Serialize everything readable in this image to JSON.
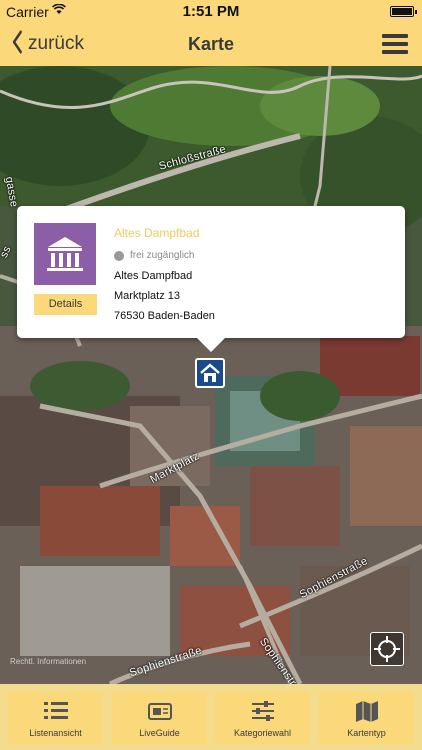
{
  "status_bar": {
    "carrier": "Carrier",
    "time": "1:51 PM"
  },
  "nav": {
    "back_label": "zurück",
    "title": "Karte"
  },
  "map": {
    "streets": {
      "schloss": "Schloßstraße",
      "marktplatz": "Marktplatz",
      "sophien_right": "Sophienstraße",
      "sophien_bottom": "Sophienstraße",
      "sophien_diag": "Sophienstr",
      "gasse": "gasse",
      "ss_left": "ss"
    },
    "attribution": "Rechtl. Informationen"
  },
  "popup": {
    "title": "Altes Dampfbad",
    "access": "frei zugänglich",
    "address_lines": [
      "Altes Dampfbad",
      "Marktplatz 13",
      "76530 Baden-Baden"
    ],
    "details_label": "Details",
    "icon_color": "#8c5ea8"
  },
  "tabs": [
    {
      "label": "Listenansicht",
      "icon": "list-icon"
    },
    {
      "label": "LiveGuide",
      "icon": "liveguide-icon"
    },
    {
      "label": "Kategoriewahl",
      "icon": "sliders-icon"
    },
    {
      "label": "Kartentyp",
      "icon": "map-icon"
    }
  ],
  "colors": {
    "accent": "#fbd97a",
    "title_accent": "#f5c95a",
    "marker": "#1a4a8a"
  }
}
